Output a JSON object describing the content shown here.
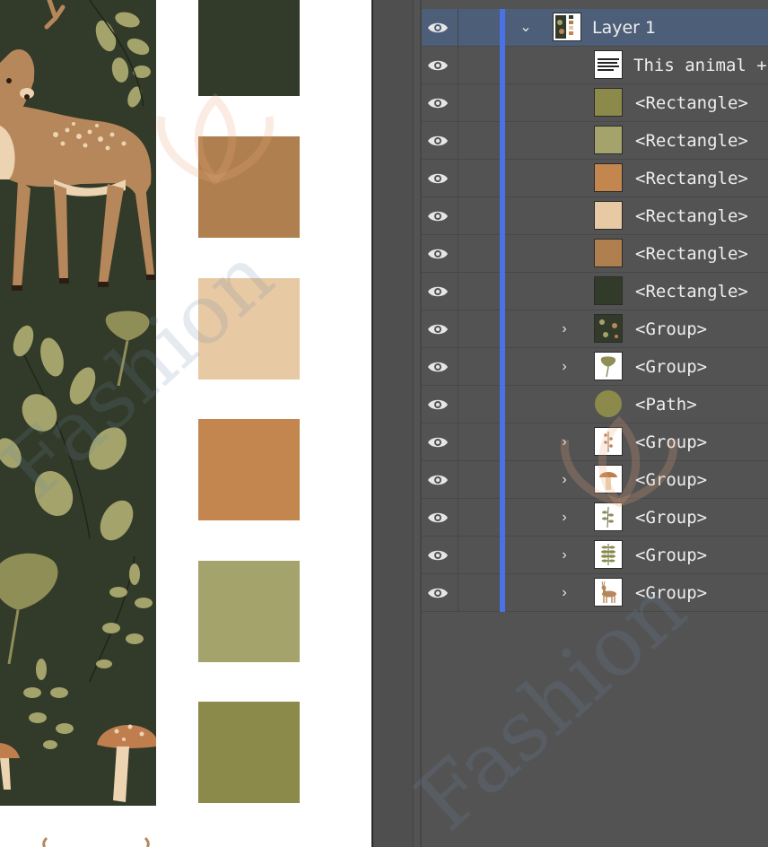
{
  "colors": {
    "pattern_bg": "#323a29",
    "leaf": "#a3a36b",
    "deer_body": "#b6875a",
    "deer_light": "#ecd3b2",
    "mushroom_cap": "#c07e4f",
    "ginkgo": "#8f8e57",
    "panel_bg": "#535353",
    "selected_row": "#4c5e78",
    "layer_color_bar": "#4a72e6"
  },
  "swatches": [
    {
      "name": "dark-green",
      "color": "#323a29"
    },
    {
      "name": "tan-brown",
      "color": "#b07f4f"
    },
    {
      "name": "light-beige",
      "color": "#e7c9a4"
    },
    {
      "name": "terracotta",
      "color": "#c4864f"
    },
    {
      "name": "sage",
      "color": "#a3a36b"
    },
    {
      "name": "olive",
      "color": "#8b8a4b"
    }
  ],
  "layers_panel": {
    "parent_layer": {
      "label": "Layer 1",
      "expanded": true,
      "visible": true
    },
    "items": [
      {
        "label": "This animal + fo",
        "kind": "text",
        "thumb": "text-preview",
        "has_children": false
      },
      {
        "label": "<Rectangle>",
        "kind": "rectangle",
        "thumb_color": "#8b8a4b",
        "has_children": false
      },
      {
        "label": "<Rectangle>",
        "kind": "rectangle",
        "thumb_color": "#a3a36b",
        "has_children": false
      },
      {
        "label": "<Rectangle>",
        "kind": "rectangle",
        "thumb_color": "#c4864f",
        "has_children": false
      },
      {
        "label": "<Rectangle>",
        "kind": "rectangle",
        "thumb_color": "#e7c9a4",
        "has_children": false
      },
      {
        "label": "<Rectangle>",
        "kind": "rectangle",
        "thumb_color": "#b07f4f",
        "has_children": false
      },
      {
        "label": "<Rectangle>",
        "kind": "rectangle",
        "thumb_color": "#323a29",
        "has_children": false
      },
      {
        "label": "<Group>",
        "kind": "group",
        "thumb": "pattern-icon",
        "has_children": true
      },
      {
        "label": "<Group>",
        "kind": "group",
        "thumb": "ginkgo-icon",
        "has_children": true
      },
      {
        "label": "<Path>",
        "kind": "path",
        "thumb": "circle-icon",
        "thumb_color": "#8b8a4b",
        "has_children": false
      },
      {
        "label": "<Group>",
        "kind": "group",
        "thumb": "berry-branch-icon",
        "has_children": true
      },
      {
        "label": "<Group>",
        "kind": "group",
        "thumb": "mushroom-icon",
        "has_children": true
      },
      {
        "label": "<Group>",
        "kind": "group",
        "thumb": "sprig-icon",
        "has_children": true
      },
      {
        "label": "<Group>",
        "kind": "group",
        "thumb": "fern-icon",
        "has_children": true
      },
      {
        "label": "<Group>",
        "kind": "group",
        "thumb": "deer-icon",
        "has_children": true
      }
    ]
  },
  "watermark_icon": "lotus-logo-icon"
}
